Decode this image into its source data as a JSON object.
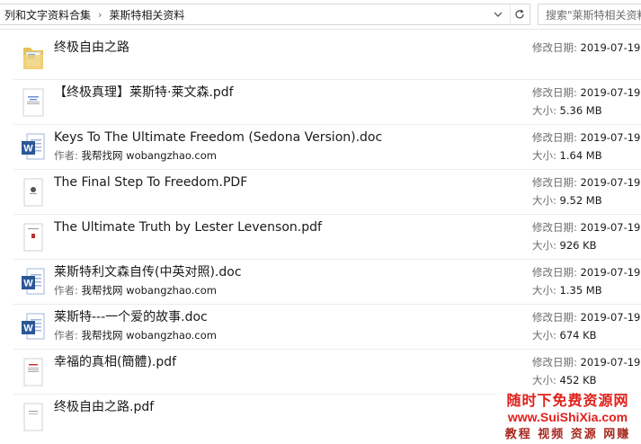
{
  "address_bar": {
    "crumbs": [
      "列和文字资料合集",
      "莱斯特相关资料"
    ],
    "separator": "›",
    "search_placeholder": "搜索\"莱斯特相关资料\""
  },
  "labels": {
    "modified": "修改日期:",
    "size": "大小:",
    "author": "作者:"
  },
  "files": [
    {
      "name": "终极自由之路",
      "type": "folder",
      "modified": "2019-07-19",
      "size": "",
      "author": ""
    },
    {
      "name": "【终极真理】莱斯特·莱文森.pdf",
      "type": "pdf",
      "modified": "2019-07-19",
      "size": "5.36 MB",
      "author": ""
    },
    {
      "name": "Keys To The Ultimate Freedom (Sedona Version).doc",
      "type": "doc",
      "modified": "2019-07-19",
      "size": "1.64 MB",
      "author": "我帮找网 wobangzhao.com"
    },
    {
      "name": "The Final Step To Freedom.PDF",
      "type": "pdf",
      "modified": "2019-07-19",
      "size": "9.52 MB",
      "author": ""
    },
    {
      "name": "The Ultimate Truth by Lester Levenson.pdf",
      "type": "pdf",
      "modified": "2019-07-19",
      "size": "926 KB",
      "author": ""
    },
    {
      "name": "莱斯特利文森自传(中英对照).doc",
      "type": "doc",
      "modified": "2019-07-19",
      "size": "1.35 MB",
      "author": "我帮找网 wobangzhao.com"
    },
    {
      "name": "莱斯特---一个爱的故事.doc",
      "type": "doc",
      "modified": "2019-07-19",
      "size": "674 KB",
      "author": "我帮找网 wobangzhao.com"
    },
    {
      "name": "幸福的真相(簡體).pdf",
      "type": "pdf",
      "modified": "2019-07-19",
      "size": "452 KB",
      "author": ""
    },
    {
      "name": "终极自由之路.pdf",
      "type": "pdf",
      "modified": "",
      "size": "",
      "author": ""
    }
  ],
  "watermark": {
    "line1": "随时下免费资源网",
    "line2": "www.SuiShiXia.com",
    "line3": "教程 视频 资源 网赚"
  },
  "colors": {
    "folder": "#e8c15a",
    "doc_blue": "#2b5797",
    "watermark_red": "#e0201b"
  }
}
